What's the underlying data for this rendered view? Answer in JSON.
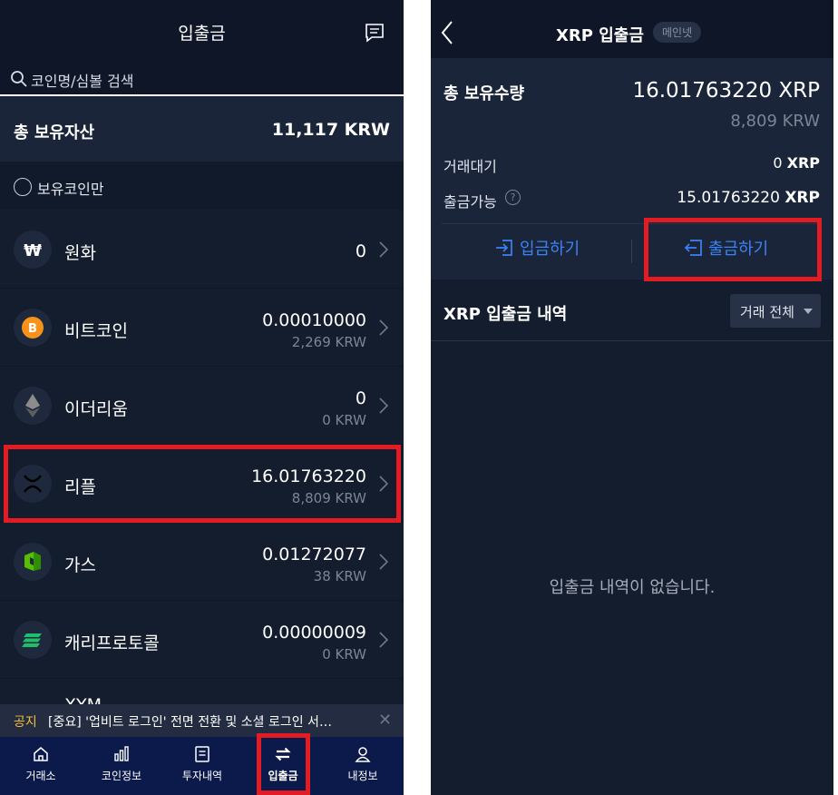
{
  "left": {
    "title": "입출금",
    "search": {
      "placeholder": "코인명/심볼 검색"
    },
    "total": {
      "label": "총 보유자산",
      "value": "11,117 KRW"
    },
    "filter_label": "보유코인만",
    "coins": [
      {
        "name": "원화",
        "amount": "0",
        "krw": "",
        "icon": "won-icon",
        "color": "#ffffff"
      },
      {
        "name": "비트코인",
        "amount": "0.00010000",
        "krw": "2,269 KRW",
        "icon": "bitcoin-icon",
        "color": "#f7931a"
      },
      {
        "name": "이더리움",
        "amount": "0",
        "krw": "0 KRW",
        "icon": "ethereum-icon",
        "color": "#8c8c8c"
      },
      {
        "name": "리플",
        "amount": "16.01763220",
        "krw": "8,809 KRW",
        "icon": "xrp-icon",
        "color": "#000000"
      },
      {
        "name": "가스",
        "amount": "0.01272077",
        "krw": "38 KRW",
        "icon": "gas-icon",
        "color": "#58bf00"
      },
      {
        "name": "캐리프로토콜",
        "amount": "0.00000009",
        "krw": "0 KRW",
        "icon": "carry-icon",
        "color": "#1fbf6a"
      }
    ],
    "partial_row_name": "XYM",
    "notice": {
      "tag": "공지",
      "text": "[중요] '업비트 로그인' 전면 전환 및 소셜 로그인 서…"
    },
    "nav": [
      {
        "label": "거래소",
        "icon": "home-icon"
      },
      {
        "label": "코인정보",
        "icon": "chart-bars-icon"
      },
      {
        "label": "투자내역",
        "icon": "document-icon"
      },
      {
        "label": "입출금",
        "icon": "transfer-arrows-icon",
        "active": true
      },
      {
        "label": "내정보",
        "icon": "person-icon"
      }
    ]
  },
  "right": {
    "title": "XRP 입출금",
    "network_badge": "메인넷",
    "holdings": {
      "label": "총 보유수량",
      "value": "16.01763220 XRP",
      "krw": "8,809 KRW",
      "pending_label": "거래대기",
      "pending_amount": "0",
      "pending_unit": "XRP",
      "available_label": "출금가능",
      "available_amount": "15.01763220",
      "available_unit": "XRP"
    },
    "deposit_label": "입금하기",
    "withdraw_label": "출금하기",
    "history_title": "XRP 입출금 내역",
    "history_filter": "거래 전체",
    "empty_text": "입출금 내역이 없습니다."
  },
  "colors": {
    "background": "#141d2e",
    "header": "#0f1628",
    "accent_blue": "#3b82f6",
    "highlight_red": "#e31b23",
    "notice_yellow": "#f2c037",
    "nav_bar": "#0b1a4a"
  }
}
